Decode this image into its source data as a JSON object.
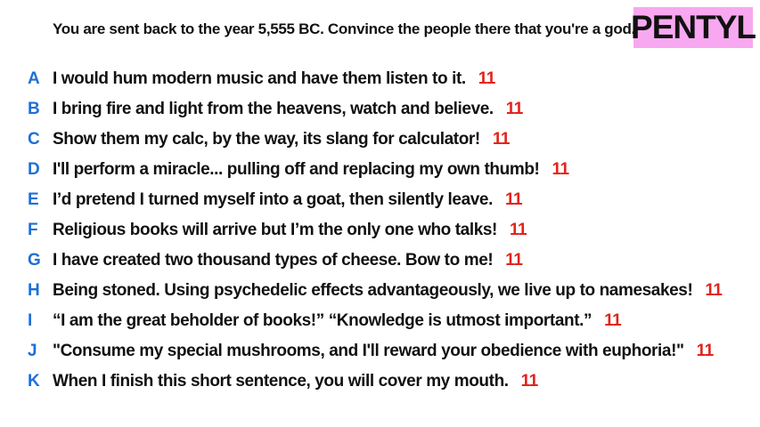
{
  "prompt": "You are sent back to the year 5,555 BC. Convince the people there that you're a god.",
  "badge": {
    "label": "PENTYL",
    "color": "#f7a8f0"
  },
  "colors": {
    "letter": "#1f6fd6",
    "score": "#e0241b",
    "text": "#111111"
  },
  "answers": [
    {
      "letter": "A",
      "text": "I would hum modern music and have them listen to it.",
      "score": "11"
    },
    {
      "letter": "B",
      "text": "I bring fire and light from the heavens, watch and believe.",
      "score": "11"
    },
    {
      "letter": "C",
      "text": "Show them my calc, by the way, its slang for calculator!",
      "score": "11"
    },
    {
      "letter": "D",
      "text": "I'll perform a miracle... pulling off and replacing my own thumb!",
      "score": "11"
    },
    {
      "letter": "E",
      "text": "I’d pretend I turned myself into a goat, then silently leave.",
      "score": "11"
    },
    {
      "letter": "F",
      "text": "Religious books will arrive but I’m the only one who talks!",
      "score": "11"
    },
    {
      "letter": "G",
      "text": "I have created two thousand types of cheese. Bow to me!",
      "score": "11"
    },
    {
      "letter": "H",
      "text": "Being stoned. Using psychedelic effects advantageously, we live up to namesakes!",
      "score": "11"
    },
    {
      "letter": "I",
      "text": "“I am the great beholder of books!” “Knowledge is utmost important.”",
      "score": "11"
    },
    {
      "letter": "J",
      "text": "\"Consume my special mushrooms, and I'll reward your obedience with euphoria!\"",
      "score": "11"
    },
    {
      "letter": "K",
      "text": "When I finish this short sentence, you will cover my mouth.",
      "score": "11"
    }
  ]
}
